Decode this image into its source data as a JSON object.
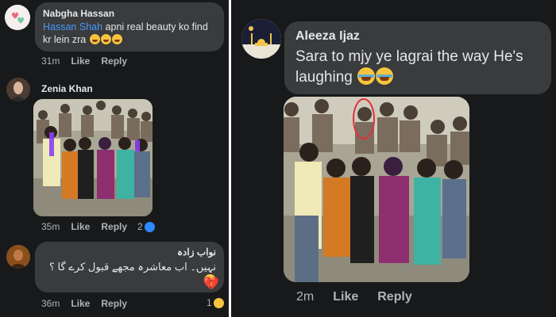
{
  "left": {
    "comments": [
      {
        "author": "Nabgha Hassan",
        "mention": "Hassan Shah",
        "text": " apni real beauty ko find kr lein zra",
        "time": "31m",
        "like": "Like",
        "reply": "Reply"
      },
      {
        "author": "Zenia Khan",
        "time": "35m",
        "like": "Like",
        "reply": "Reply",
        "reaction_count": "2"
      },
      {
        "author": "نواب زادہ",
        "text": "نہیں۔ اب معاشرہ مجھے قبول کرے گا ؟",
        "time": "36m",
        "like": "Like",
        "reply": "Reply",
        "reaction_count": "1"
      }
    ]
  },
  "right": {
    "comment": {
      "author": "Aleeza Ijaz",
      "text": "Sara to mjy ye lagrai the way He's laughing",
      "time": "2m",
      "like": "Like",
      "reply": "Reply"
    }
  },
  "colors": {
    "background": "#18191a",
    "bubble": "#3a3b3c",
    "mention": "#4599ff",
    "meta": "#b0b3b8",
    "heart": "#e0245e"
  }
}
